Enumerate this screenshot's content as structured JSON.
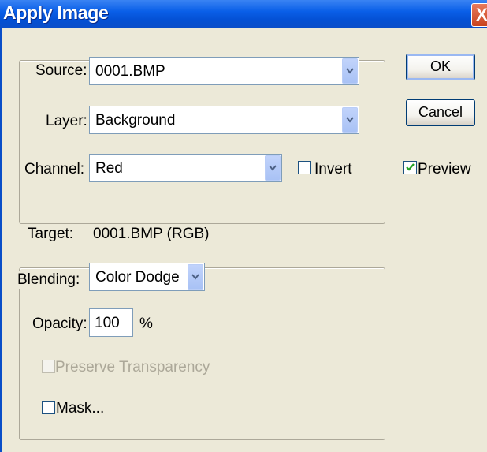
{
  "window": {
    "title": "Apply Image",
    "close_glyph": "X"
  },
  "source_group": {
    "source_label": "Source:",
    "source_value": "0001.BMP",
    "layer_label": "Layer:",
    "layer_value": "Background",
    "channel_label": "Channel:",
    "channel_value": "Red",
    "invert_label": "Invert",
    "invert_checked": false
  },
  "buttons": {
    "ok_label": "OK",
    "cancel_label": "Cancel"
  },
  "preview": {
    "label": "Preview",
    "checked": true
  },
  "target": {
    "label": "Target:",
    "value": "0001.BMP (RGB)"
  },
  "blending_group": {
    "blending_label": "Blending:",
    "blending_value": "Color Dodge",
    "opacity_label": "Opacity:",
    "opacity_value": "100",
    "opacity_unit": "%",
    "preserve_label": "Preserve Transparency",
    "preserve_checked": false,
    "preserve_enabled": false,
    "mask_label": "Mask...",
    "mask_checked": false
  },
  "colors": {
    "titlebar": "#0a5fe8",
    "dialog_bg": "#ece9d8",
    "check_green": "#21a121"
  },
  "icons": {
    "dropdown": "chevron-down-icon",
    "close": "close-icon",
    "check": "checkmark-icon"
  }
}
